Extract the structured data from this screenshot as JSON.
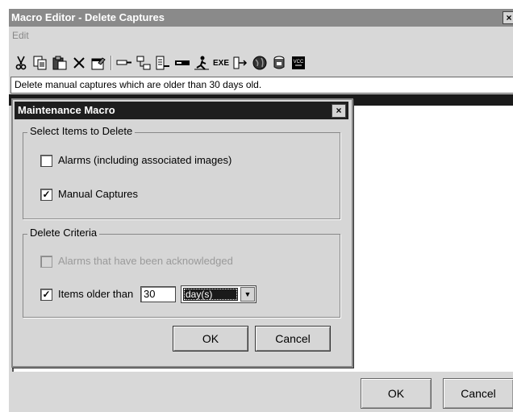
{
  "window": {
    "title": "Macro Editor - Delete Captures",
    "close_glyph": "×"
  },
  "menu": [
    "Edit"
  ],
  "toolbar": {
    "icons": [
      "cut-icon",
      "copy-icon",
      "paste-icon",
      "delete-icon",
      "properties-icon",
      "key-icon",
      "network-icon",
      "output-icon",
      "bar-icon",
      "person-icon",
      "exe-icon",
      "flow-icon",
      "globe-icon",
      "disk-icon",
      "vcc-icon"
    ],
    "exe_label": "EXE",
    "vcc_label": "VCC"
  },
  "description": "Delete manual captures which are older than 30 days old.",
  "dialog": {
    "title": "Maintenance Macro",
    "close_glyph": "×",
    "select_group": {
      "label": "Select Items to Delete",
      "alarms": {
        "label": "Alarms (including associated images)",
        "checked": false
      },
      "manual": {
        "label": "Manual Captures",
        "checked": true
      }
    },
    "criteria_group": {
      "label": "Delete Criteria",
      "acknowledged": {
        "label": "Alarms that have been acknowledged",
        "checked": false,
        "disabled": true
      },
      "older": {
        "label": "Items older than",
        "checked": true,
        "value": "30",
        "unit": "day(s)"
      }
    },
    "ok_label": "OK",
    "cancel_label": "Cancel"
  },
  "footer": {
    "ok_label": "OK",
    "cancel_label": "Cancel"
  },
  "check_glyph": "✓"
}
